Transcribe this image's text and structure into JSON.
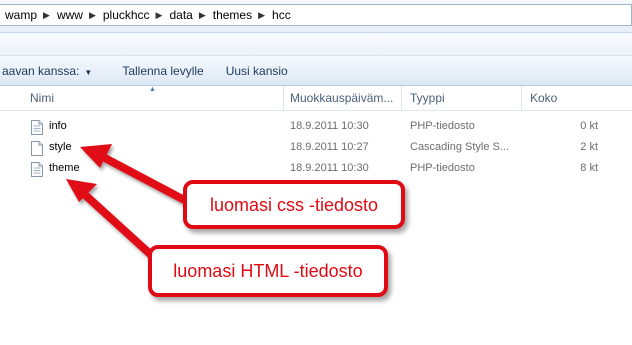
{
  "breadcrumb": [
    "wamp",
    "www",
    "pluckhcc",
    "data",
    "themes",
    "hcc"
  ],
  "commands": {
    "organize": "aavan kanssa:",
    "save": "Tallenna levylle",
    "new_folder": "Uusi kansio"
  },
  "columns": {
    "name": "Nimi",
    "modified": "Muokkauspäiväm...",
    "type": "Tyyppi",
    "size": "Koko"
  },
  "files": [
    {
      "name": "info",
      "date": "18.9.2011 10:30",
      "type": "PHP-tiedosto",
      "size": "0 kt"
    },
    {
      "name": "style",
      "date": "18.9.2011 10:27",
      "type": "Cascading Style S...",
      "size": "2 kt"
    },
    {
      "name": "theme",
      "date": "18.9.2011 10:30",
      "type": "PHP-tiedosto",
      "size": "8 kt"
    }
  ],
  "annotations": {
    "css": "luomasi css -tiedosto",
    "html": "luomasi HTML -tiedosto"
  },
  "colors": {
    "accent": "#e00a14",
    "header_text": "#4c607a"
  }
}
